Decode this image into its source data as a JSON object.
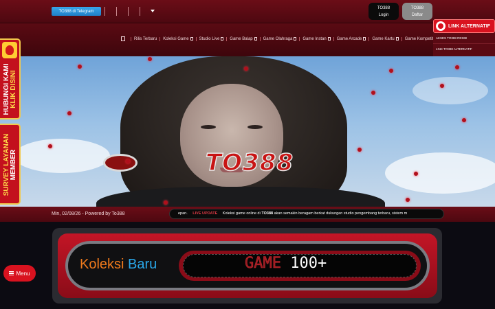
{
  "topbar": {
    "telegram_label": "TO388 di Telegram",
    "login": {
      "line1": "TO388",
      "line2": "Login"
    },
    "register": {
      "line1": "TO388",
      "line2": "Daftar"
    }
  },
  "nav": {
    "items": [
      "Rilis Terbaru",
      "Koleksi Game",
      "Studio Live",
      "Game Balap",
      "Game Olahraga",
      "Game Instan",
      "Game Arcade",
      "Game Kartu",
      "Game Kompetitif"
    ]
  },
  "link_alternatif": {
    "label": "LINK ALTERNATIF",
    "items": [
      "AKSES TO388 RESMI",
      "LINK TO388 ALTERNATIF"
    ]
  },
  "side": {
    "contact": {
      "line1": "HUBUNGI KAMI",
      "line2": "KLIK DISINI"
    },
    "survey": {
      "line1": "SURVEY LAYANAN",
      "line2": "MEMBER"
    }
  },
  "banner": {
    "wordmark": "TO388"
  },
  "info": {
    "date": "Min, 02/08/26 - Powered by To388",
    "ticker_prefix": "epan.",
    "ticker_live": "LIVE UPDATE",
    "ticker_text_a": "Koleksi game online di",
    "ticker_brand": "TO388",
    "ticker_text_b": "akan semakin beragam berkat dukungan studio pengembang terbaru, sistem m"
  },
  "collection": {
    "word1": "Koleksi",
    "word2": "Baru",
    "game_word": "GAME",
    "count": "100+"
  },
  "menu_button": {
    "label": "Menu"
  },
  "colors": {
    "brand_red": "#d9121f",
    "accent_orange": "#f07a1c",
    "accent_blue": "#2aa7e8",
    "gold": "#f2c94c"
  }
}
